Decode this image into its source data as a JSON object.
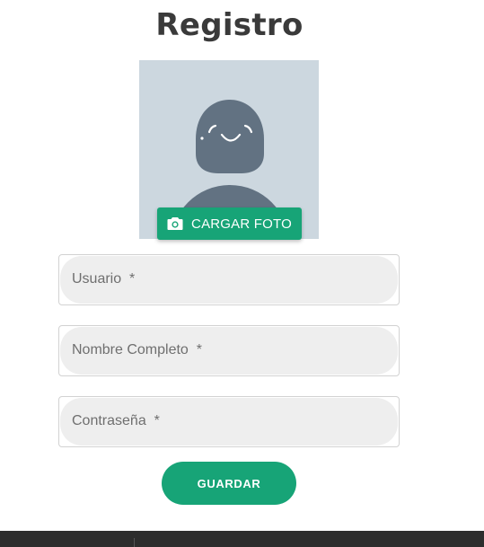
{
  "page": {
    "title": "Registro"
  },
  "photo": {
    "upload_label": "CARGAR FOTO",
    "upload_icon": "camera-icon"
  },
  "form": {
    "fields": [
      {
        "label": "Usuario",
        "required_mark": "*"
      },
      {
        "label": "Nombre Completo",
        "required_mark": "*"
      },
      {
        "label": "Contraseña",
        "required_mark": "*"
      }
    ],
    "save_label": "GUARDAR"
  },
  "colors": {
    "accent": "#17a477",
    "avatar_bg": "#ccd7df",
    "avatar_figure": "#627282",
    "field_bg": "#eeeeee",
    "title": "#3a3a3a",
    "footer": "#2d2d2d"
  }
}
